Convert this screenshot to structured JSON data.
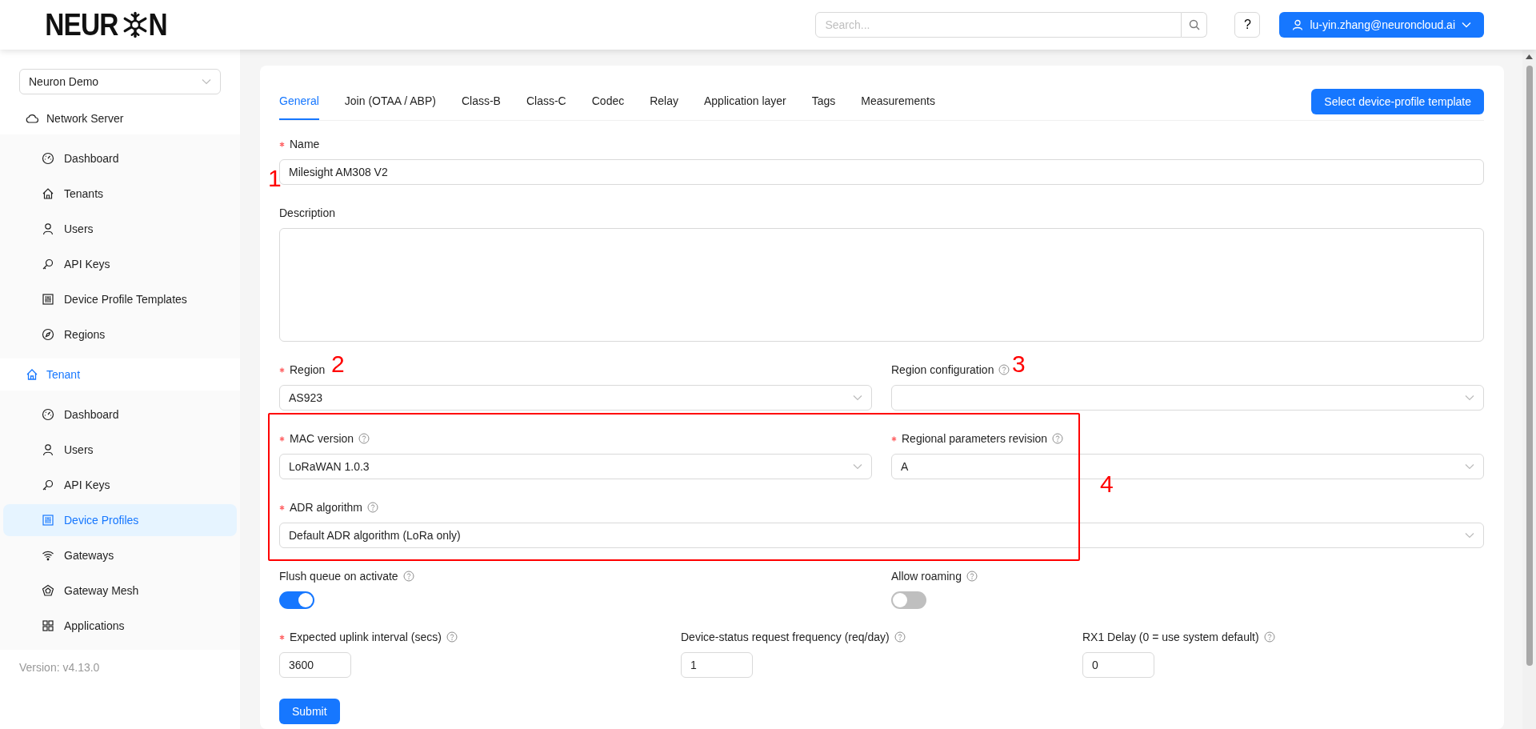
{
  "header": {
    "logo_text_start": "NEUR",
    "logo_text_end": "N",
    "search": {
      "placeholder": "Search..."
    },
    "help_button": "?",
    "user_menu": "lu-yin.zhang@neuroncloud.ai"
  },
  "sidebar": {
    "tenant_select": "Neuron Demo",
    "sections": [
      {
        "label": "Network Server",
        "selected": false,
        "items": [
          {
            "label": "Dashboard",
            "selected": false
          },
          {
            "label": "Tenants",
            "selected": false
          },
          {
            "label": "Users",
            "selected": false
          },
          {
            "label": "API Keys",
            "selected": false
          },
          {
            "label": "Device Profile Templates",
            "selected": false
          },
          {
            "label": "Regions",
            "selected": false
          }
        ]
      },
      {
        "label": "Tenant",
        "selected": true,
        "items": [
          {
            "label": "Dashboard",
            "selected": false
          },
          {
            "label": "Users",
            "selected": false
          },
          {
            "label": "API Keys",
            "selected": false
          },
          {
            "label": "Device Profiles",
            "selected": true
          },
          {
            "label": "Gateways",
            "selected": false
          },
          {
            "label": "Gateway Mesh",
            "selected": false
          },
          {
            "label": "Applications",
            "selected": false
          }
        ]
      }
    ],
    "version": "Version: v4.13.0"
  },
  "tabs": [
    {
      "label": "General",
      "selected": true
    },
    {
      "label": "Join (OTAA / ABP)",
      "selected": false
    },
    {
      "label": "Class-B",
      "selected": false
    },
    {
      "label": "Class-C",
      "selected": false
    },
    {
      "label": "Codec",
      "selected": false
    },
    {
      "label": "Relay",
      "selected": false
    },
    {
      "label": "Application layer",
      "selected": false
    },
    {
      "label": "Tags",
      "selected": false
    },
    {
      "label": "Measurements",
      "selected": false
    }
  ],
  "template_button": "Select device-profile template",
  "form_rows": [
    [
      {
        "kind": "input",
        "label": "Name",
        "required": true,
        "help": false,
        "value": "Milesight AM308 V2"
      }
    ],
    [
      {
        "kind": "textarea",
        "label": "Description",
        "required": false,
        "help": false
      }
    ],
    [
      {
        "kind": "select",
        "label": "Region",
        "required": true,
        "help": false,
        "value": "AS923"
      },
      {
        "kind": "select",
        "label": "Region configuration",
        "required": false,
        "help": true
      }
    ],
    [
      {
        "kind": "select",
        "label": "MAC version",
        "required": true,
        "help": true,
        "value": "LoRaWAN 1.0.3"
      },
      {
        "kind": "select",
        "label": "Regional parameters revision",
        "required": true,
        "help": true,
        "value": "A"
      }
    ],
    [
      {
        "kind": "select",
        "label": "ADR algorithm",
        "required": true,
        "help": true,
        "value": "Default ADR algorithm (LoRa only)"
      }
    ],
    [
      {
        "kind": "switch",
        "label": "Flush queue on activate",
        "required": false,
        "help": true,
        "on": true
      },
      {
        "kind": "switch",
        "label": "Allow roaming",
        "required": false,
        "help": true,
        "on": false
      }
    ],
    [
      {
        "kind": "number",
        "label": "Expected uplink interval (secs)",
        "required": true,
        "help": true,
        "value": "3600"
      },
      {
        "kind": "number",
        "label": "Device-status request frequency (req/day)",
        "required": false,
        "help": true,
        "value": "1"
      },
      {
        "kind": "number",
        "label": "RX1 Delay (0 = use system default)",
        "required": false,
        "help": true,
        "value": "0"
      }
    ]
  ],
  "submit_button": "Submit",
  "annotations": [
    {
      "kind": "number",
      "text": "1"
    },
    {
      "kind": "number",
      "text": "2"
    },
    {
      "kind": "number",
      "text": "3"
    },
    {
      "kind": "frame"
    },
    {
      "kind": "number",
      "text": "4"
    }
  ]
}
